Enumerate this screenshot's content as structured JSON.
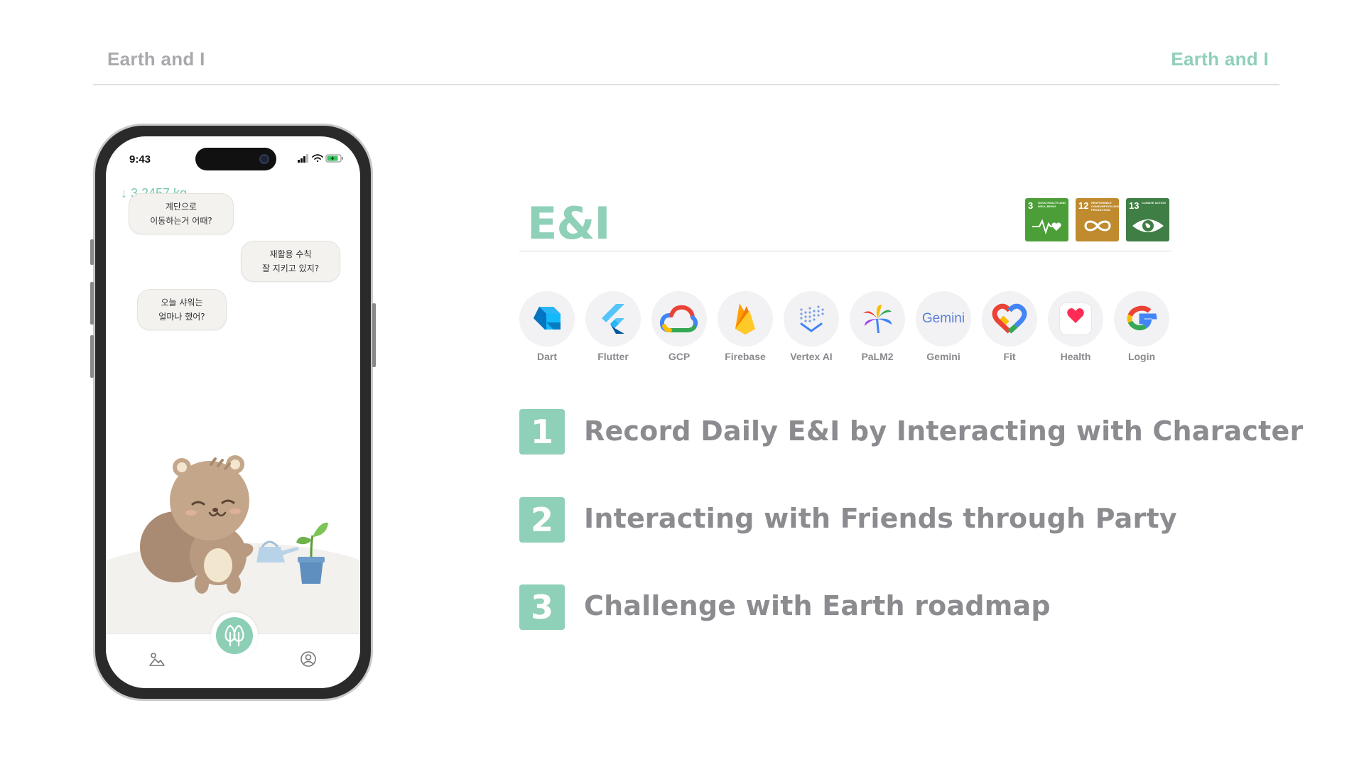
{
  "header": {
    "left_title": "Earth and I",
    "right_title": "Earth and I"
  },
  "phone": {
    "status_time": "9:43",
    "weight": "↓ 3.2457 kg",
    "bubbles": [
      {
        "line1": "계단으로",
        "line2": "이동하는거 어때?"
      },
      {
        "line1": "재활용 수칙",
        "line2": "잘 지키고 있지?"
      },
      {
        "line1": "오늘 샤워는",
        "line2": "얼마나 했어?"
      }
    ],
    "tabs": [
      "gallery-icon",
      "tree-icon",
      "profile-icon"
    ]
  },
  "panel": {
    "title": "E&I",
    "sdgs": [
      {
        "number": "3",
        "caption": "Good health and well-being",
        "color": "#4c9f38"
      },
      {
        "number": "12",
        "caption": "Responsible consumption and production",
        "color": "#bf8b2e"
      },
      {
        "number": "13",
        "caption": "Climate action",
        "color": "#3f7e44"
      }
    ],
    "tech_stack": [
      {
        "label": "Dart",
        "icon": "dart-icon"
      },
      {
        "label": "Flutter",
        "icon": "flutter-icon"
      },
      {
        "label": "GCP",
        "icon": "gcp-icon"
      },
      {
        "label": "Firebase",
        "icon": "firebase-icon"
      },
      {
        "label": "Vertex AI",
        "icon": "vertex-ai-icon"
      },
      {
        "label": "PaLM2",
        "icon": "palm2-icon"
      },
      {
        "label": "Gemini",
        "icon": "gemini-icon"
      },
      {
        "label": "Fit",
        "icon": "google-fit-icon"
      },
      {
        "label": "Health",
        "icon": "apple-health-icon"
      },
      {
        "label": "Login",
        "icon": "google-login-icon"
      }
    ],
    "gemini_wordmark": "Gemini",
    "features": [
      {
        "number": "1",
        "text": "Record Daily E&I by Interacting with Character"
      },
      {
        "number": "2",
        "text": "Interacting with Friends through Party"
      },
      {
        "number": "3",
        "text": "Challenge with Earth roadmap"
      }
    ]
  },
  "colors": {
    "accent": "#8fd0b8",
    "muted_text": "#8b8b90",
    "header_gray": "#a9a9ad"
  }
}
